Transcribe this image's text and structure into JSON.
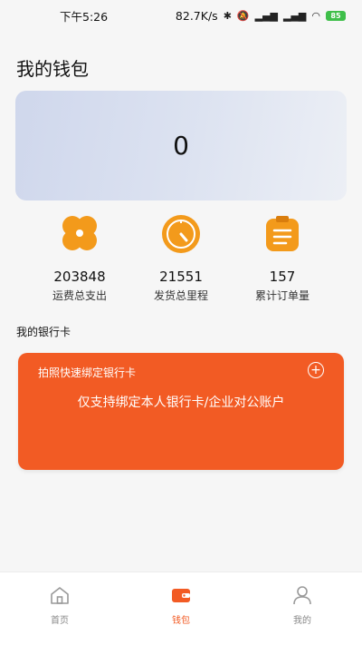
{
  "status": {
    "time": "下午5:26",
    "speed": "82.7K/s",
    "battery": "85"
  },
  "page": {
    "title": "我的钱包"
  },
  "balance": {
    "value": "0"
  },
  "stats": [
    {
      "value": "203848",
      "label": "运费总支出",
      "icon": "clover-icon"
    },
    {
      "value": "21551",
      "label": "发货总里程",
      "icon": "timer-icon"
    },
    {
      "value": "157",
      "label": "累计订单量",
      "icon": "clipboard-icon"
    }
  ],
  "bank": {
    "section_title": "我的银行卡",
    "bind_text": "拍照快速绑定银行卡",
    "add_symbol": "+",
    "notice": "仅支持绑定本人银行卡/企业对公账户"
  },
  "tabbar": {
    "items": [
      {
        "label": "首页",
        "icon": "home-icon"
      },
      {
        "label": "钱包",
        "icon": "wallet-icon"
      },
      {
        "label": "我的",
        "icon": "user-icon"
      }
    ],
    "active_index": 1
  },
  "colors": {
    "accent": "#f25b24",
    "stat_icon": "#f39a1b",
    "card_gradient_start": "#cfd7ec"
  }
}
